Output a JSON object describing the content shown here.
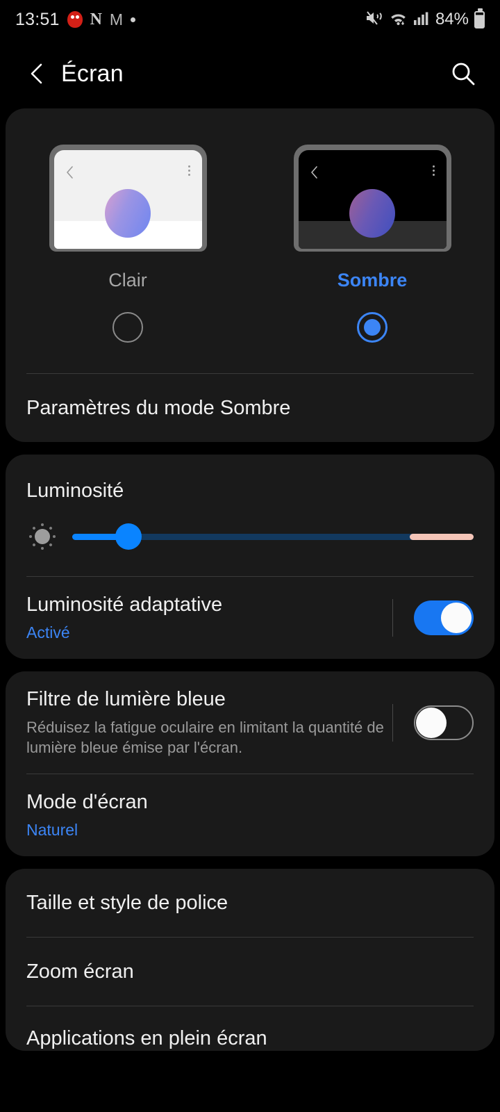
{
  "status_bar": {
    "time": "13:51",
    "left_icons": [
      "app-red-icon",
      "netflix-n-icon",
      "gmail-m-icon",
      "dot-icon"
    ],
    "netflix_glyph": "N",
    "gmail_glyph": "M",
    "right_icons": [
      "mute-vibrate-icon",
      "wifi-icon",
      "cellular-signal-icon"
    ],
    "battery_percent": "84%"
  },
  "header": {
    "back_icon": "back-chevron-icon",
    "title": "Écran",
    "search_icon": "search-icon"
  },
  "theme_card": {
    "options": [
      {
        "label": "Clair",
        "selected": false
      },
      {
        "label": "Sombre",
        "selected": true
      }
    ],
    "dark_mode_settings_label": "Paramètres du mode Sombre",
    "selected_color": "#3c85f5",
    "unselected_color": "#a8a8a8"
  },
  "brightness_card": {
    "title": "Luminosité",
    "icon": "brightness-sun-icon",
    "slider": {
      "value_percent": 14,
      "warm_zone_start_percent": 84,
      "fill_color": "#0a84ff",
      "track_color": "#12395f",
      "warm_color": "#f5c5b8"
    },
    "adaptive": {
      "title": "Luminosité adaptative",
      "status": "Activé",
      "status_color": "#3c85f5",
      "toggle_on": true
    }
  },
  "blue_light_card": {
    "filter": {
      "title": "Filtre de lumière bleue",
      "description": "Réduisez la fatigue oculaire en limitant la quantité de lumière bleue émise par l'écran.",
      "toggle_on": false
    },
    "screen_mode": {
      "title": "Mode d'écran",
      "value": "Naturel",
      "value_color": "#3c85f5"
    }
  },
  "font_card": {
    "items": [
      {
        "title": "Taille et style de police"
      },
      {
        "title": "Zoom écran"
      },
      {
        "title": "Applications en plein écran"
      }
    ]
  }
}
